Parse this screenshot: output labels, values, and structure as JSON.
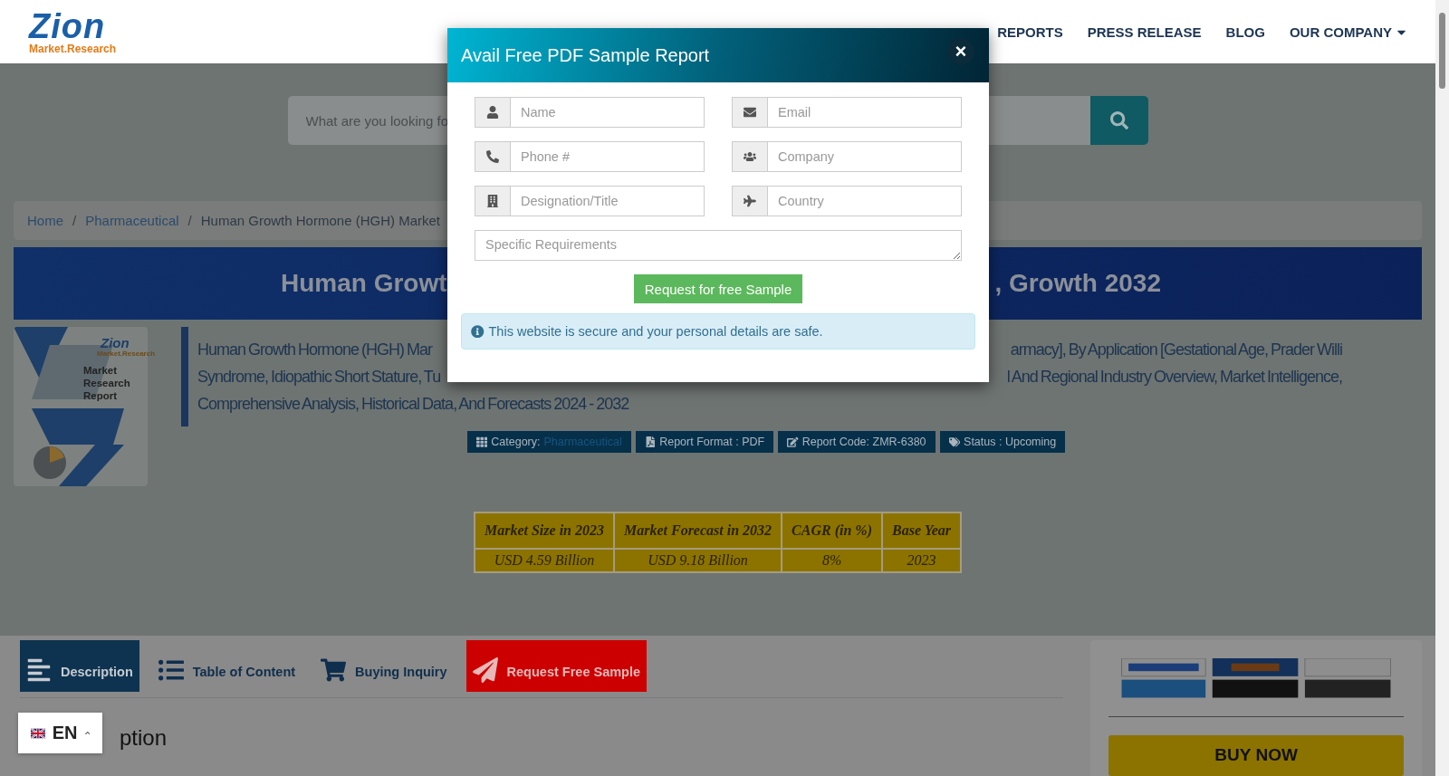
{
  "logo": {
    "name": "Zion",
    "tagline": "Market.Research"
  },
  "nav": [
    {
      "label": "REPORTS",
      "dropdown": false
    },
    {
      "label": "PRESS RELEASE",
      "dropdown": false
    },
    {
      "label": "BLOG",
      "dropdown": false
    },
    {
      "label": "OUR COMPANY",
      "dropdown": true
    }
  ],
  "search": {
    "placeholder": "What are you looking fo"
  },
  "breadcrumb": [
    {
      "label": "Home",
      "link": true
    },
    {
      "separator": "/",
      "label": "Pharmaceutical",
      "link": true
    },
    {
      "separator": "/",
      "label": "Human Growth Hormone (HGH) Market",
      "link": false
    }
  ],
  "title": {
    "left": "Human Growt",
    "right": ", Growth 2032"
  },
  "thumbnail": {
    "logo": "Zion",
    "tagline": "Market.Research",
    "caption": "Market Research Report"
  },
  "description": [
    {
      "left": "Human Growth Hormone (HGH) Mar",
      "right": "armacy], By Application [Gestational Age, Prader Willi"
    },
    {
      "left": "Syndrome, Idiopathic Short Stature, Tu",
      "right": "l And Regional Industry Overview, Market Intelligence,"
    },
    {
      "left": "Comprehensive Analysis, Historical Data, And Forecasts 2024 - 2032"
    }
  ],
  "badges": [
    {
      "label": "Category:",
      "link": "Pharmaceutical"
    },
    {
      "label": "Report Format : PDF"
    },
    {
      "label": "Report Code: ZMR-6380"
    },
    {
      "label": "Status : Upcoming"
    }
  ],
  "stats_table": {
    "columns": [
      "Market Size in 2023",
      "Market Forecast in 2032",
      "CAGR (in %)",
      "Base Year"
    ],
    "rows": [
      [
        "USD 4.59 Billion",
        "USD 9.18 Billion",
        "8%",
        "2023"
      ]
    ]
  },
  "tabs": [
    {
      "label": "Description",
      "selected": true,
      "kind": "tab"
    },
    {
      "label": "Table of Content",
      "selected": false,
      "kind": "tab"
    },
    {
      "label": "Buying Inquiry",
      "selected": false,
      "kind": "tab"
    },
    {
      "label": "Request Free Sample",
      "selected": false,
      "kind": "cta"
    }
  ],
  "section_heading": "ption",
  "sidebar": {
    "button": "BUY NOW"
  },
  "language": {
    "code": "EN"
  },
  "modal": {
    "title": "Avail Free PDF Sample Report",
    "close": "×",
    "fields": [
      {
        "placeholder": "Name"
      },
      {
        "placeholder": "Email"
      },
      {
        "placeholder": "Phone #"
      },
      {
        "placeholder": "Company"
      },
      {
        "placeholder": "Designation/Title"
      },
      {
        "placeholder": "Country"
      }
    ],
    "textarea": {
      "placeholder": "Specific Requirements"
    },
    "submit": "Request for free Sample",
    "notice": "This website is secure and your personal details are safe."
  }
}
